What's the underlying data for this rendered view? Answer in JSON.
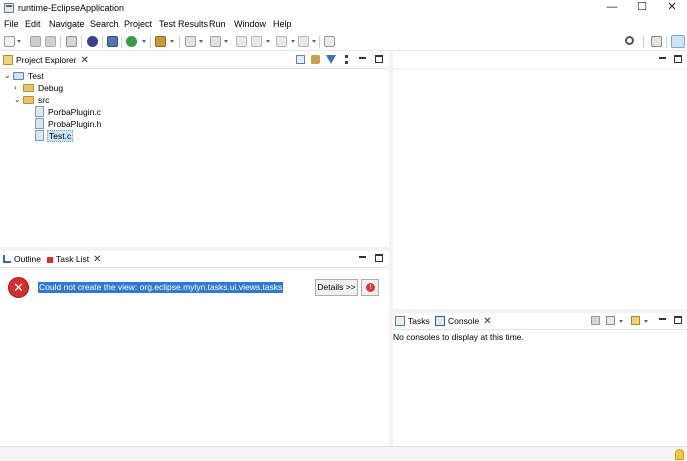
{
  "window": {
    "title": "runtime-EclipseApplication",
    "minimize_glyph": "—",
    "maximize_glyph": "☐",
    "close_glyph": "✕"
  },
  "menu": [
    "File",
    "Edit",
    "Navigate",
    "Search",
    "Project",
    "Test Results",
    "Run",
    "Window",
    "Help"
  ],
  "toolbar": {
    "icons": [
      "new-icon",
      "save-icon",
      "save-all-icon",
      "print-icon",
      "build-icon",
      "debug-icon",
      "run-icon",
      "external-tools-icon",
      "next-annotation-icon",
      "previous-annotation-icon",
      "back-icon",
      "forward-icon",
      "pin-editor-icon",
      "search-icon",
      "open-perspective-icon",
      "cpp-perspective-icon"
    ]
  },
  "project_explorer": {
    "tab_label": "Project Explorer",
    "close_glyph": "✕",
    "tree": {
      "project": "Test",
      "folders": [
        "Debug",
        "src"
      ],
      "files": [
        "PorbaPlugin.c",
        "ProbaPlugin.h",
        "Test.c"
      ]
    }
  },
  "bottom_left": {
    "tabs": [
      "Outline",
      "Task List"
    ],
    "error_message": "Could not create the view: org.eclipse.mylyn.tasks.ui.views.tasks",
    "details_button": "Details >>",
    "error_glyph": "✕",
    "stop_glyph": "!"
  },
  "bottom_right": {
    "tabs": [
      "Tasks",
      "Console"
    ],
    "console_message": "No consoles to display at this time."
  },
  "colors": {
    "selection": "#3079d1",
    "error": "#d32f2f",
    "folder": "#e8c46a",
    "accent": "#2f5fa8"
  }
}
